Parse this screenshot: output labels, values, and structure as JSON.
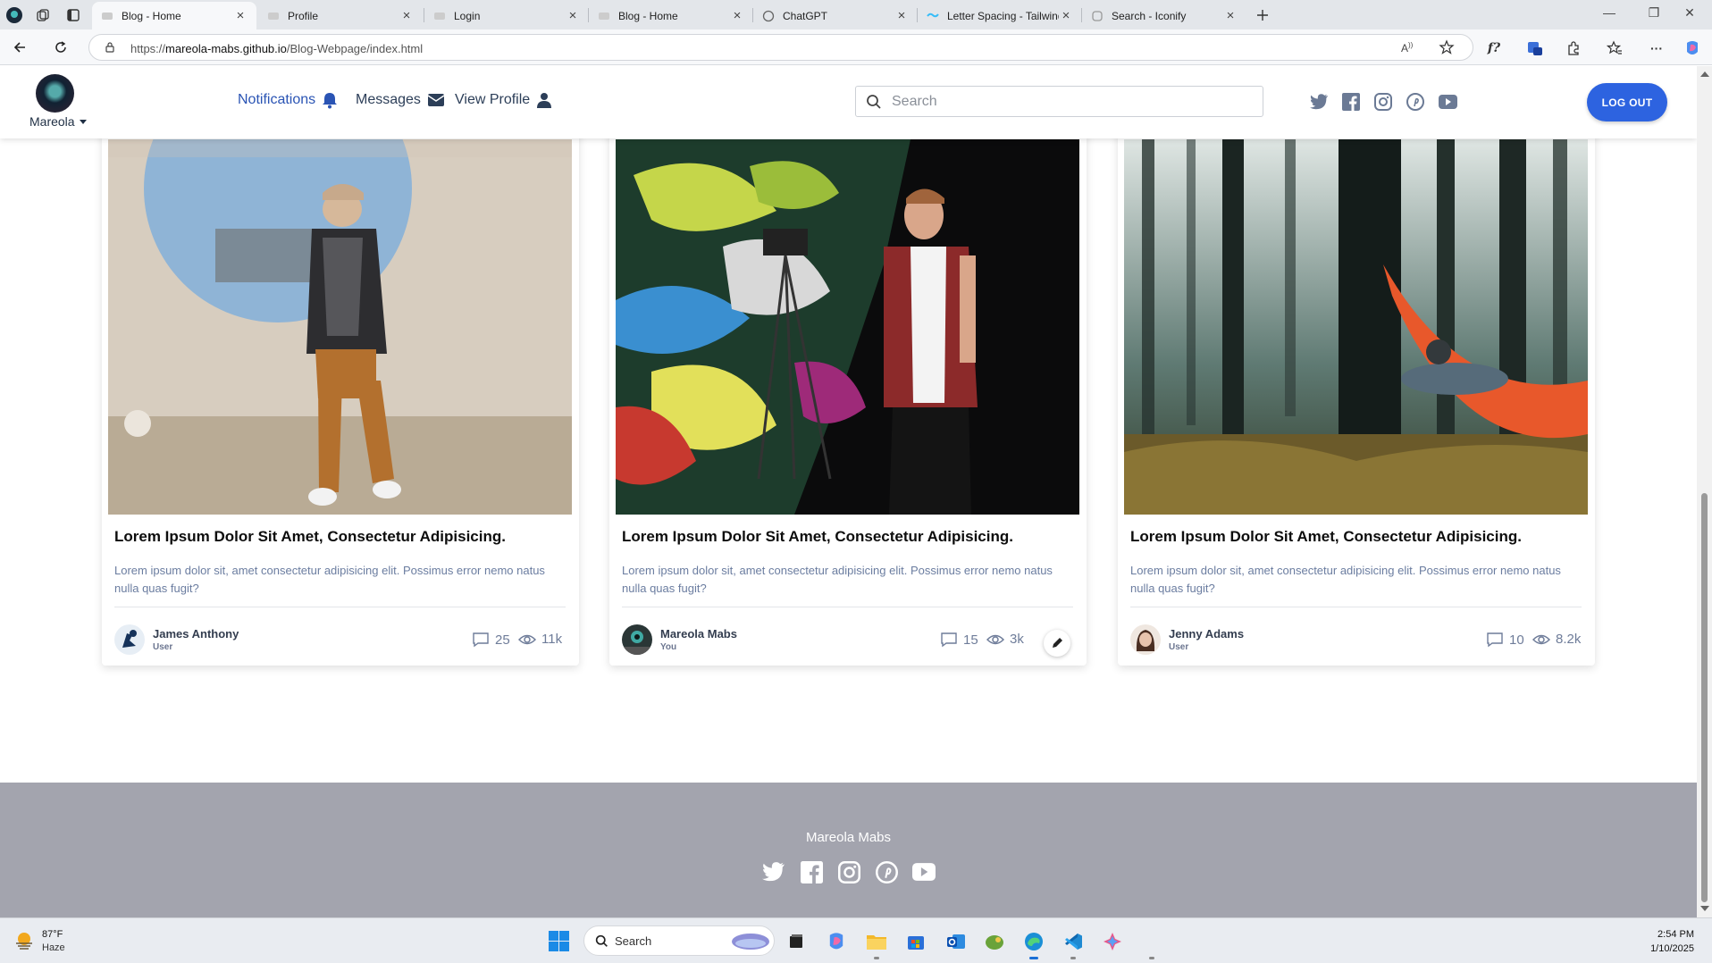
{
  "browser": {
    "tabs": [
      {
        "title": "Blog - Home",
        "active": true
      },
      {
        "title": "Profile",
        "active": false
      },
      {
        "title": "Login",
        "active": false
      },
      {
        "title": "Blog - Home",
        "active": false
      },
      {
        "title": "ChatGPT",
        "active": false
      },
      {
        "title": "Letter Spacing - Tailwind CSS",
        "active": false
      },
      {
        "title": "Search - Iconify",
        "active": false
      }
    ],
    "url_prefix": "https://",
    "url_host": "mareola-mabs.github.io",
    "url_path": "/Blog-Webpage/index.html"
  },
  "header": {
    "username": "Mareola",
    "nav": {
      "notifications": "Notifications",
      "messages": "Messages",
      "view_profile": "View Profile"
    },
    "search_placeholder": "Search",
    "logout_label": "LOG OUT",
    "social_icons": [
      "twitter-icon",
      "facebook-icon",
      "instagram-icon",
      "pinterest-icon",
      "youtube-icon"
    ]
  },
  "posts": [
    {
      "title": "Lorem Ipsum Dolor Sit Amet, Consectetur Adipisicing.",
      "excerpt": "Lorem ipsum dolor sit, amet consectetur adipisicing elit. Possimus error nemo natus nulla quas fugit?",
      "author": "James Anthony",
      "role": "User",
      "comments": "25",
      "views": "11k",
      "editable": false
    },
    {
      "title": "Lorem Ipsum Dolor Sit Amet, Consectetur Adipisicing.",
      "excerpt": "Lorem ipsum dolor sit, amet consectetur adipisicing elit. Possimus error nemo natus nulla quas fugit?",
      "author": "Mareola Mabs",
      "role": "You",
      "comments": "15",
      "views": "3k",
      "editable": true
    },
    {
      "title": "Lorem Ipsum Dolor Sit Amet, Consectetur Adipisicing.",
      "excerpt": "Lorem ipsum dolor sit, amet consectetur adipisicing elit. Possimus error nemo natus nulla quas fugit?",
      "author": "Jenny Adams",
      "role": "User",
      "comments": "10",
      "views": "8.2k",
      "editable": false
    }
  ],
  "footer": {
    "name": "Mareola Mabs"
  },
  "taskbar": {
    "weather_temp": "87°F",
    "weather_cond": "Haze",
    "search_label": "Search",
    "time": "2:54 PM",
    "date": "1/10/2025"
  },
  "colors": {
    "primary": "#2d63e0",
    "nav_active": "#2a54b4",
    "footer_bg": "#a3a4ae",
    "muted_text": "#6b7da0"
  }
}
